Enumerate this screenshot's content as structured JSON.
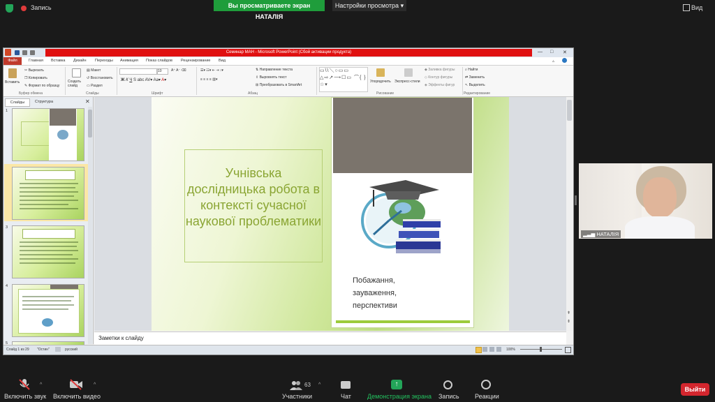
{
  "zoom": {
    "record_label": "Запись",
    "share_banner": "Вы просматриваете экран НАТАЛІЯ",
    "view_settings": "Настройки просмотра",
    "view_button": "Вид",
    "participant_name": "НАТАЛІЯ",
    "participants_count": "63",
    "controls": {
      "mute": "Включить звук",
      "video": "Включить видео",
      "participants": "Участники",
      "chat": "Чат",
      "share": "Демонстрация экрана",
      "record": "Запись",
      "reactions": "Реакции",
      "leave": "Выйти"
    },
    "colors": {
      "share_green": "#1f9d3b",
      "leave_red": "#d3262e"
    }
  },
  "ppt": {
    "window_title": "Семинар МАН - Microsoft PowerPoint (Сбой активации продукта)",
    "menu": [
      "Файл",
      "Главная",
      "Вставка",
      "Дизайн",
      "Переходы",
      "Анимация",
      "Показ слайдов",
      "Рецензирование",
      "Вид"
    ],
    "ribbon": {
      "paste": "Вставить",
      "cut": "Вырезать",
      "copy": "Копировать",
      "format_painter": "Формат по образцу",
      "new_slide": "Создать слайд",
      "layout": "Макет",
      "reset": "Восстановить",
      "section": "Раздел",
      "font_size": "10",
      "text_direction": "Направление текста",
      "align_text": "Выровнять текст",
      "smartart": "Преобразовать в SmartArt",
      "arrange": "Упорядочить",
      "quick_styles": "Экспресс-стили",
      "shape_fill": "Заливка фигуры",
      "shape_outline": "Контур фигуры",
      "shape_effects": "Эффекты фигур",
      "find": "Найти",
      "replace": "Заменить",
      "select": "Выделить",
      "groups": [
        "Буфер обмена",
        "Слайды",
        "Шрифт",
        "Абзац",
        "Рисование",
        "Редактирование"
      ]
    },
    "panel_tabs": [
      "Слайды",
      "Структура"
    ],
    "slide_numbers": [
      "1",
      "2",
      "3",
      "4",
      "5"
    ],
    "slide": {
      "title": "Учнівська дослідницька робота в контексті сучасної наукової проблематики",
      "wishes": [
        "Побажання,",
        "зауваження,",
        "перспективи"
      ]
    },
    "notes_placeholder": "Заметки к слайду",
    "status": {
      "slide_info": "Слайд 1 из 29",
      "theme": "\"Остин\"",
      "language": "русский",
      "zoom": "100%"
    }
  }
}
